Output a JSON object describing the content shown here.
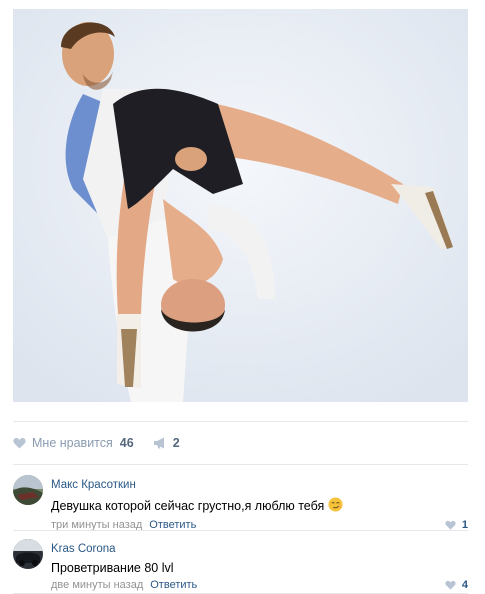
{
  "post": {
    "photo_alt": "",
    "likes": {
      "label": "Мне нравится",
      "count": "46"
    },
    "shares": {
      "count": "2"
    }
  },
  "comments": [
    {
      "author": "Макс Красоткин",
      "text": "Девушка которой сейчас грустно,я люблю тебя",
      "emoji": "smirk-face",
      "time": "три минуты назад",
      "reply_label": "Ответить",
      "likes": "1"
    },
    {
      "author": "Kras Corona",
      "text": "Проветривание 80 lvl",
      "time": "две минуты назад",
      "reply_label": "Ответить",
      "likes": "4"
    }
  ],
  "colors": {
    "link": "#2a5885",
    "muted": "#939393",
    "icon": "#b8c4d3"
  }
}
